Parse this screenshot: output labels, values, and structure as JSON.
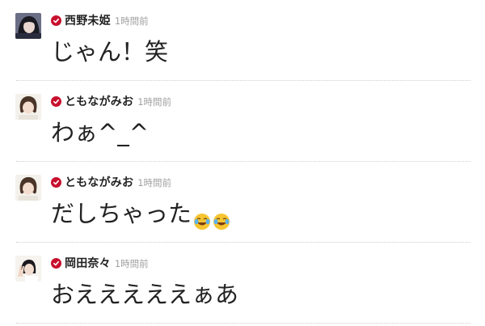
{
  "comments": [
    {
      "name": "西野未姫",
      "time": "1時間前",
      "text": "じゃん！笑",
      "verified": true,
      "avatar_icon": "avatar-dark-hair",
      "emojis": []
    },
    {
      "name": "ともながみお",
      "time": "1時間前",
      "text": "わぁ^_^",
      "verified": true,
      "avatar_icon": "avatar-bob-hair",
      "emojis": []
    },
    {
      "name": "ともながみお",
      "time": "1時間前",
      "text": "だしちゃった",
      "verified": true,
      "avatar_icon": "avatar-bob-hair",
      "emojis": [
        "face-with-tears-of-joy",
        "face-with-tears-of-joy"
      ]
    },
    {
      "name": "岡田奈々",
      "time": "1時間前",
      "text": "おえええええぁあ",
      "verified": true,
      "avatar_icon": "avatar-peace-sign",
      "emojis": []
    }
  ],
  "colors": {
    "verified_badge": "#c8102e",
    "name": "#222222",
    "time": "#a0a0a0",
    "divider": "#cfcfcf"
  }
}
